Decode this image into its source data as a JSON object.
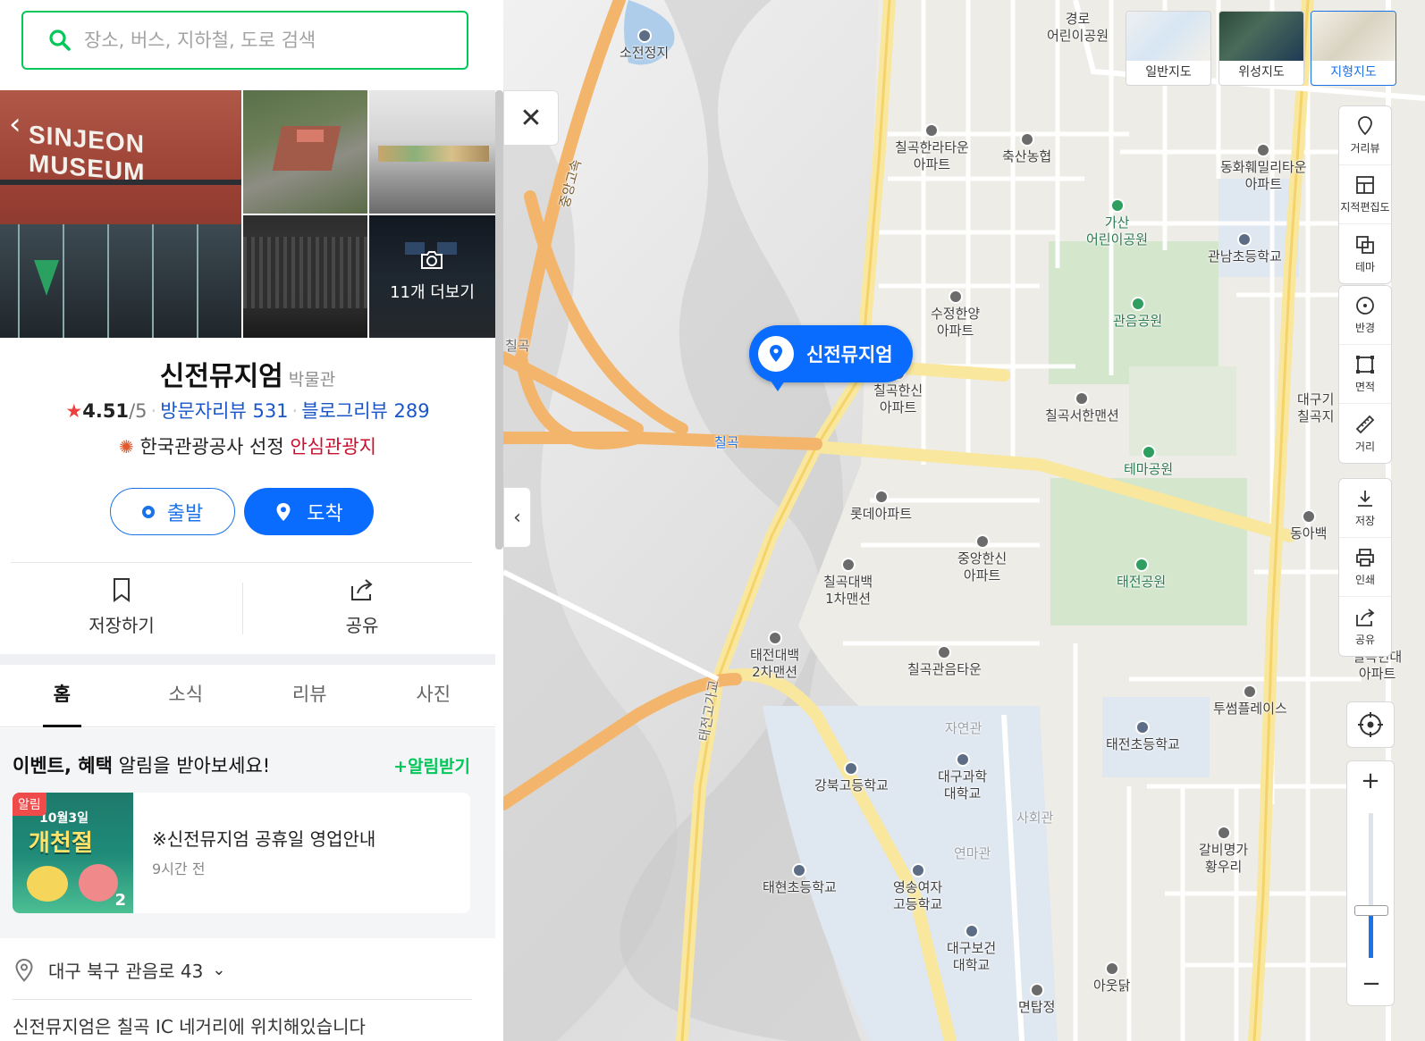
{
  "search": {
    "placeholder": "장소, 버스, 지하철, 도로 검색"
  },
  "photos": {
    "sign_text": "SINJEON MUSEUM",
    "more_label": "11개 더보기"
  },
  "place": {
    "name": "신전뮤지엄",
    "category": "박물관",
    "rating": "4.51",
    "rating_max": "/5",
    "visitor_reviews": "방문자리뷰 531",
    "blog_reviews": "블로그리뷰 289",
    "badge_text": "한국관광공사 선정",
    "badge_highlight": "안심관광지"
  },
  "actions": {
    "start": "출발",
    "arrive": "도착",
    "save": "저장하기",
    "share": "공유"
  },
  "tabs": [
    "홈",
    "소식",
    "리뷰",
    "사진"
  ],
  "notification": {
    "headline_bold": "이벤트, 혜택",
    "headline_rest": " 알림을 받아보세요!",
    "subscribe": "+알림받기",
    "card": {
      "tag": "알림",
      "thumb_line1": "10월3일",
      "thumb_line2": "개천절",
      "thumb_count": "2",
      "title": "※신전뮤지엄 공휴일 영업안내",
      "time": "9시간 전"
    }
  },
  "address": {
    "text": "대구 북구 관음로 43",
    "directions": "신전뮤지엄은 칠곡 IC 네거리에 위치해있습니다"
  },
  "map": {
    "marker_label": "신전뮤지엄",
    "types": [
      "일반지도",
      "위성지도",
      "지형지도"
    ],
    "selected_type": "지형지도",
    "tools": [
      "거리뷰",
      "지적편집도",
      "테마",
      "반경",
      "면적",
      "거리",
      "저장",
      "인쇄",
      "공유"
    ],
    "zoom_level": 0.33,
    "labels": [
      "소전정지",
      "경로\n어린이공원",
      "칠곡한라타운\n아파트",
      "축산농협",
      "동화훼밀리타운\n아파트",
      "가산\n어린이공원",
      "관남초등학교",
      "수정한양\n아파트",
      "관음공원",
      "칠곡한신\n아파트",
      "칠곡서한맨션",
      "대구기\n칠곡지",
      "칠곡",
      "테마공원",
      "롯데아파트",
      "중앙한신\n아파트",
      "칠곡대백\n1차맨션",
      "태전공원",
      "동아백",
      "태전대백\n2차맨션",
      "칠곡관음타운",
      "칠곡현대\n아파트",
      "투썸플레이스",
      "자연관",
      "대구과학\n대학교",
      "태전초등학교",
      "강북고등학교",
      "사회관",
      "연마관",
      "갈비명가\n황우리",
      "태현초등학교",
      "영송여자\n고등학교",
      "대구보건\n대학교",
      "아웃닭",
      "면탑정",
      "중앙고속",
      "태전고가교",
      "칠곡"
    ]
  },
  "colors": {
    "naver_green": "#03c75a",
    "accent_blue": "#0a6cff",
    "red": "#c8102e"
  }
}
